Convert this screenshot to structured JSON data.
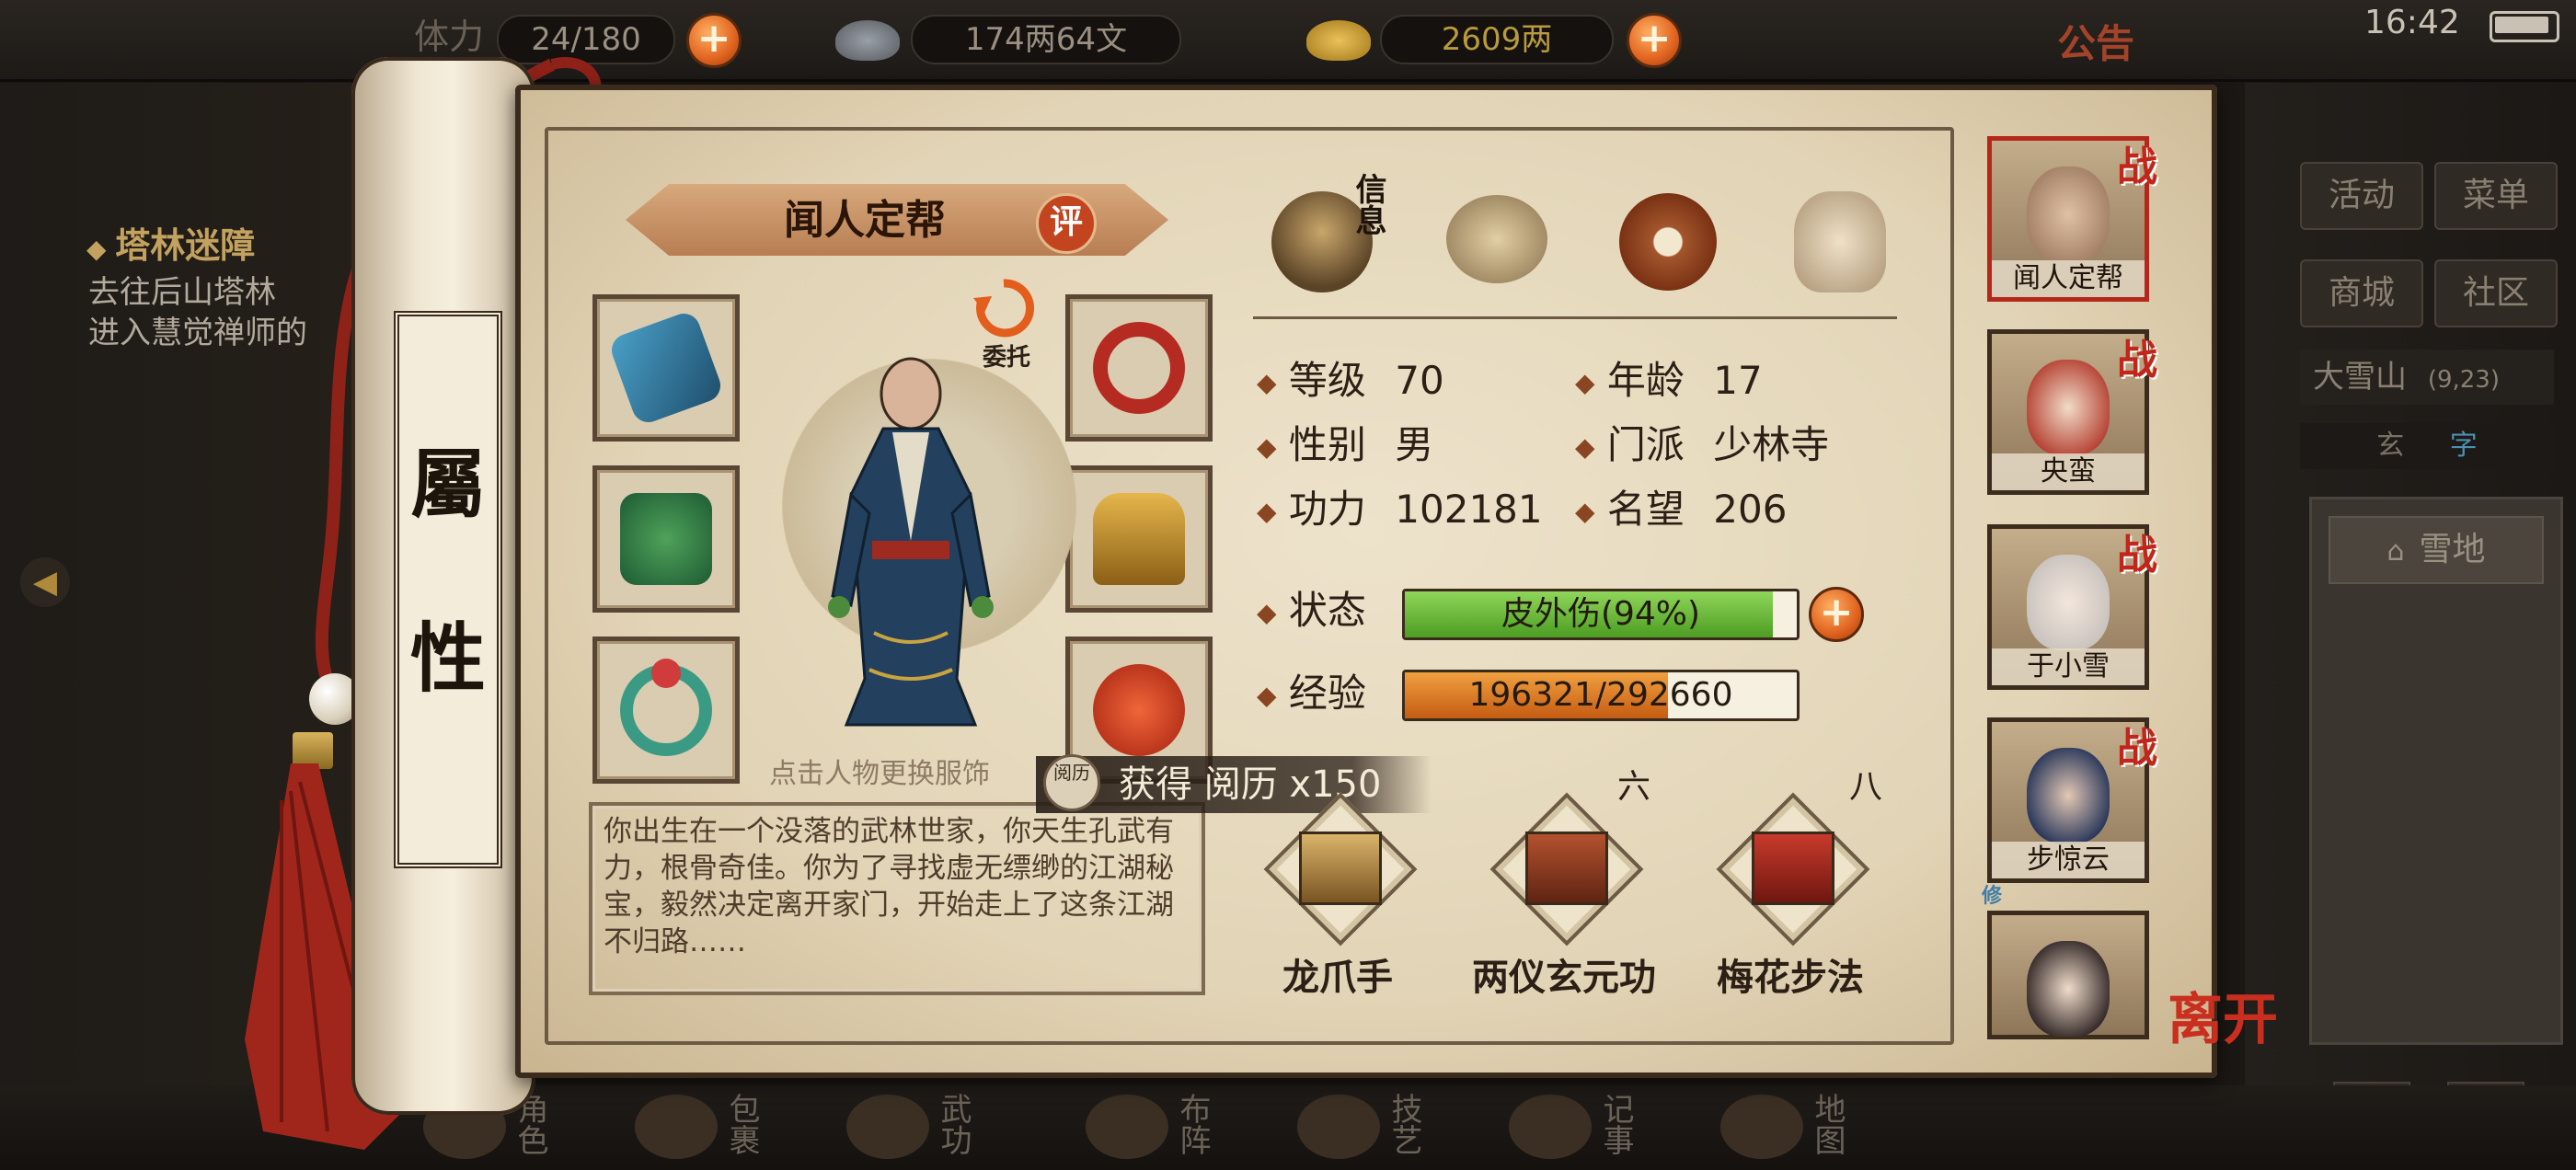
{
  "topbar": {
    "stamina": "24/180",
    "stamina_label": "体力",
    "silver": "174两64文",
    "gold": "2609两",
    "announcement": "公告",
    "clock": "16:42"
  },
  "quest": {
    "title": "塔林迷障",
    "desc_line1": "去往后山塔林",
    "desc_line2": "进入慧觉禅师的"
  },
  "right_menu": {
    "activity": "活动",
    "menu": "菜单",
    "shop": "商城",
    "community": "社区",
    "location": "大雪山",
    "coords": "(9,23)",
    "mini_tabs": [
      "玄",
      "字"
    ],
    "area": "雪地"
  },
  "bottom_nav": [
    "角色",
    "包裹",
    "武功",
    "布阵",
    "技艺",
    "记事",
    "地图"
  ],
  "scroll": {
    "title_chars": [
      "屬",
      "性"
    ]
  },
  "hero": {
    "name": "闻人定帮",
    "eval_label": "评",
    "entrust_label": "委托",
    "hint": "点击人物更换服饰",
    "story": "你出生在一个没落的武林世家，你天生孔武有力，根骨奇佳。你为了寻找虚无缥缈的江湖秘宝，毅然决定离开家门，开始走上了这条江湖不归路……"
  },
  "tabs": {
    "info_label": "信息"
  },
  "stats": {
    "level_label": "等级",
    "level": "70",
    "age_label": "年龄",
    "age": "17",
    "gender_label": "性别",
    "gender": "男",
    "sect_label": "门派",
    "sect": "少林寺",
    "power_label": "功力",
    "power": "102181",
    "fame_label": "名望",
    "fame": "206",
    "status_label": "状态",
    "status_text": "皮外伤(94%)",
    "status_pct": 94,
    "exp_label": "经验",
    "exp_text": "196321/292660",
    "exp_current": 196321,
    "exp_max": 292660
  },
  "toast": {
    "icon_text": "阅历",
    "text": "获得 阅历 x150"
  },
  "skills": [
    {
      "name": "龙爪手",
      "level": ""
    },
    {
      "name": "两仪玄元功",
      "level": "六"
    },
    {
      "name": "梅花步法",
      "level": "八"
    }
  ],
  "roster": [
    {
      "name": "闻人定帮",
      "badge": "战"
    },
    {
      "name": "央蛮",
      "badge": "战"
    },
    {
      "name": "于小雪",
      "badge": "战"
    },
    {
      "name": "步惊云",
      "badge": "战"
    },
    {
      "name": "",
      "badge": ""
    }
  ],
  "repair_label": "修",
  "leave_label": "离开",
  "colors": {
    "status_bar": "#5fb82f",
    "exp_bar": "#e07a1c",
    "accent_red": "#c0261a"
  }
}
